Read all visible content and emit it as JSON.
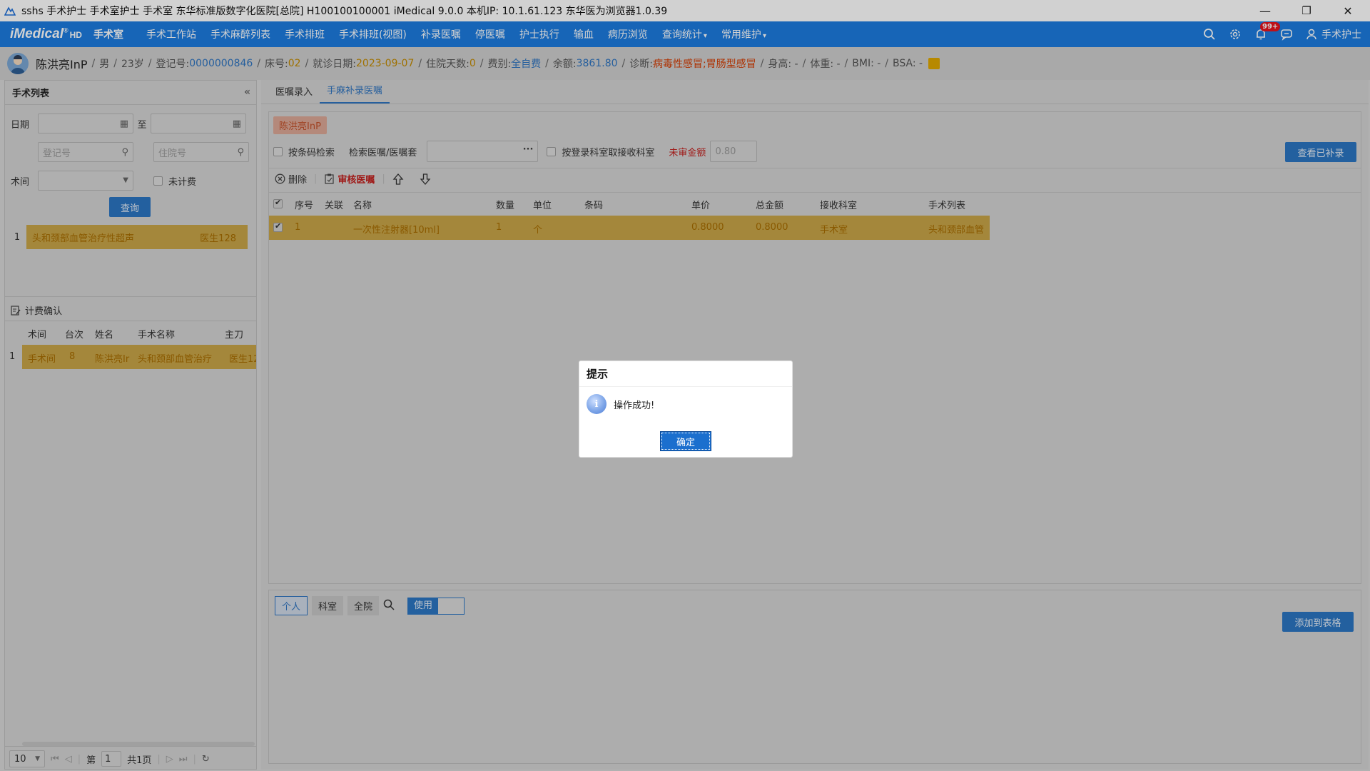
{
  "window": {
    "title": "sshs 手术护士 手术室护士 手术室 东华标准版数字化医院[总院] H100100100001 iMedical 9.0.0 本机IP: 10.1.61.123  东华医为浏览器1.0.39",
    "minimize": "—",
    "restore": "❐",
    "close": "✕"
  },
  "nav": {
    "brand": "iMedical",
    "brand_mark": "®",
    "brand_hd": "HD",
    "dept": "手术室",
    "items": [
      "手术工作站",
      "手术麻醉列表",
      "手术排班",
      "手术排班(视图)",
      "补录医嘱",
      "停医嘱",
      "护士执行",
      "输血",
      "病历浏览"
    ],
    "dropdowns": [
      "查询统计",
      "常用维护"
    ],
    "badge": "99+",
    "user": "手术护士"
  },
  "patient": {
    "name": "陈洪亮InP",
    "sex": "男",
    "age": "23岁",
    "reg_label": "登记号:",
    "reg_no": "0000000846",
    "bed_label": "床号:",
    "bed": "02",
    "visit_label": "就诊日期:",
    "visit_date": "2023-09-07",
    "stay_label": "住院天数:",
    "stay": "0",
    "fee_label": "费别:",
    "fee": "全自费",
    "balance_label": "余额:",
    "balance": "3861.80",
    "diag_label": "诊断:",
    "diag": "病毒性感冒;胃肠型感冒",
    "height": "身高: -",
    "weight": "体重: -",
    "bmi": "BMI: -",
    "bsa": "BSA: -"
  },
  "left": {
    "title": "手术列表",
    "collapse": "«",
    "date_label": "日期",
    "to_label": "至",
    "reg_placeholder": "登记号",
    "inp_placeholder": "住院号",
    "room_label": "术间",
    "uncharged_label": "未计费",
    "query": "查询",
    "list": [
      {
        "idx": "1",
        "name": "头和颈部血管治疗性超声",
        "doctor": "医生128"
      }
    ],
    "confirm_title": "计费确认",
    "confirm_cols": [
      "术间",
      "台次",
      "姓名",
      "手术名称",
      "主刀"
    ],
    "confirm_rows": [
      {
        "idx": "1",
        "room": "手术间",
        "seq": "8",
        "name": "陈洪亮Ir",
        "op": "头和颈部血管治疗",
        "surgeon": "医生12"
      }
    ],
    "pager": {
      "size": "10",
      "page_prefix": "第",
      "page": "1",
      "page_total": "共1页"
    }
  },
  "right": {
    "tabs": [
      "医嘱录入",
      "手麻补录医嘱"
    ],
    "chip": "陈洪亮InP",
    "barcode_search": "按条码检索",
    "search_label": "检索医嘱/医嘱套",
    "dept_receive": "按登录科室取接收科室",
    "unreview_label": "未审金额",
    "unreview_value": "0.80",
    "view_btn": "查看已补录",
    "delete": "删除",
    "review": "审核医嘱",
    "cols": [
      "序号",
      "关联",
      "名称",
      "数量",
      "单位",
      "条码",
      "单价",
      "总金额",
      "接收科室",
      "手术列表"
    ],
    "rows": [
      {
        "idx": "1",
        "link": "",
        "name": "一次性注射器[10ml]",
        "qty": "1",
        "unit": "个",
        "barcode": "",
        "price": "0.8000",
        "total": "0.8000",
        "dept": "手术室",
        "op": "头和颈部血管"
      }
    ],
    "scope": [
      "个人",
      "科室",
      "全院"
    ],
    "use": "使用",
    "add_btn": "添加到表格"
  },
  "dialog": {
    "title": "提示",
    "message": "操作成功!",
    "ok": "确定"
  }
}
